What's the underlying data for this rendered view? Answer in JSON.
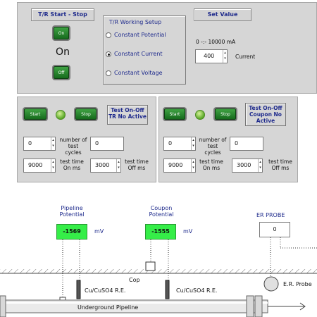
{
  "tr_panel": {
    "start_stop_title": "T/R Start - Stop",
    "on_button": "On",
    "status": "On",
    "off_button": "Off",
    "working_setup_title": "T/R Working Setup",
    "modes": [
      "Constant Potential",
      "Constant Current",
      "Constant Voltage"
    ],
    "selected_mode": "Constant Current",
    "set_value_title": "Set Value",
    "range": "0 -:- 10000 mA",
    "current_value": "400",
    "current_label": "Current"
  },
  "test_left": {
    "start_label": "Start",
    "stop_label": "Stop",
    "title": "Test On-Off TR No Active",
    "cycles_value": "0",
    "cycles_label": "number of test cycles",
    "cycles_count": "0",
    "on_ms_value": "9000",
    "on_ms_label": "test time On ms",
    "off_ms_value": "3000",
    "off_ms_label": "test time Off ms"
  },
  "test_right": {
    "start_label": "Start",
    "stop_label": "Stop",
    "title": "Test On-Off Coupon No Active",
    "cycles_value": "0",
    "cycles_label": "number of test cycles",
    "cycles_count": "0",
    "on_ms_value": "9000",
    "on_ms_label": "test time On ms",
    "off_ms_value": "3000",
    "off_ms_label": "test time Off ms"
  },
  "diagram": {
    "pipeline_potential_label": "Pipeline Potential",
    "pipeline_potential_value": "-1569",
    "unit_mv_1": "mV",
    "coupon_potential_label": "Coupon Potential",
    "coupon_potential_value": "-1555",
    "unit_mv_2": "mV",
    "er_probe_label": "ER PROBE",
    "er_probe_value": "0",
    "ref_electrode_1": "Cu/CuSO4 R.E.",
    "ref_electrode_2": "Cu/CuSO4 R.E.",
    "cop_label": "Cop",
    "er_probe_bottom": "E.R. Probe",
    "pipeline_label": "Underground Pipeline"
  }
}
